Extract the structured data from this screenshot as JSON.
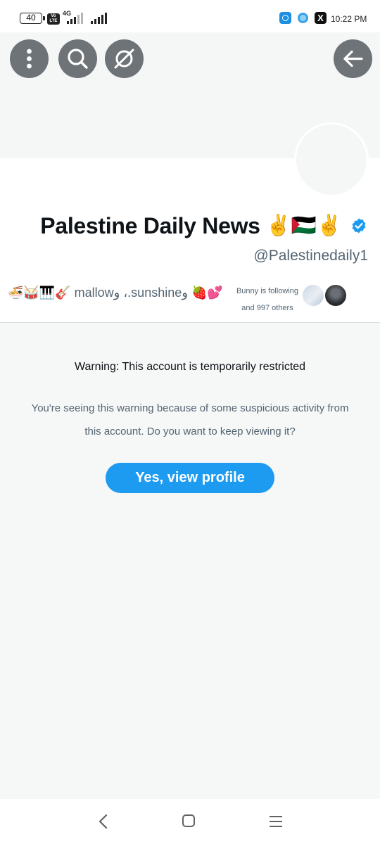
{
  "status_bar": {
    "battery": "40",
    "volte": "Vo\nLTE",
    "network": "4G",
    "time": "10:22 PM",
    "icons": [
      "circle-app-icon",
      "globe-icon",
      "x-icon"
    ]
  },
  "header": {
    "icons": [
      "more-icon",
      "search-icon",
      "hide-icon",
      "back-arrow-icon"
    ],
    "button_color": "#6e7378"
  },
  "profile": {
    "display_name": "Palestine Daily News",
    "name_emojis": "✌️🇵🇸✌️",
    "verified_color": "#1d9bf0",
    "handle": "@Palestinedaily1",
    "followers_names": "🍜🥁🎹🎸 mallowو ،.sunshineو 🍓💕",
    "followers_text_line1": "Bunny is following",
    "followers_text_line2": "and 997 others"
  },
  "warning": {
    "title": "Warning: This account is temporarily restricted",
    "body": "You're seeing this warning because of some suspicious activity from this account. Do you want to keep viewing it?",
    "button_label": "Yes, view profile",
    "accent": "#1d9bf0"
  },
  "navbar": {
    "icons": [
      "nav-back-icon",
      "nav-home-icon",
      "nav-recents-icon"
    ]
  }
}
